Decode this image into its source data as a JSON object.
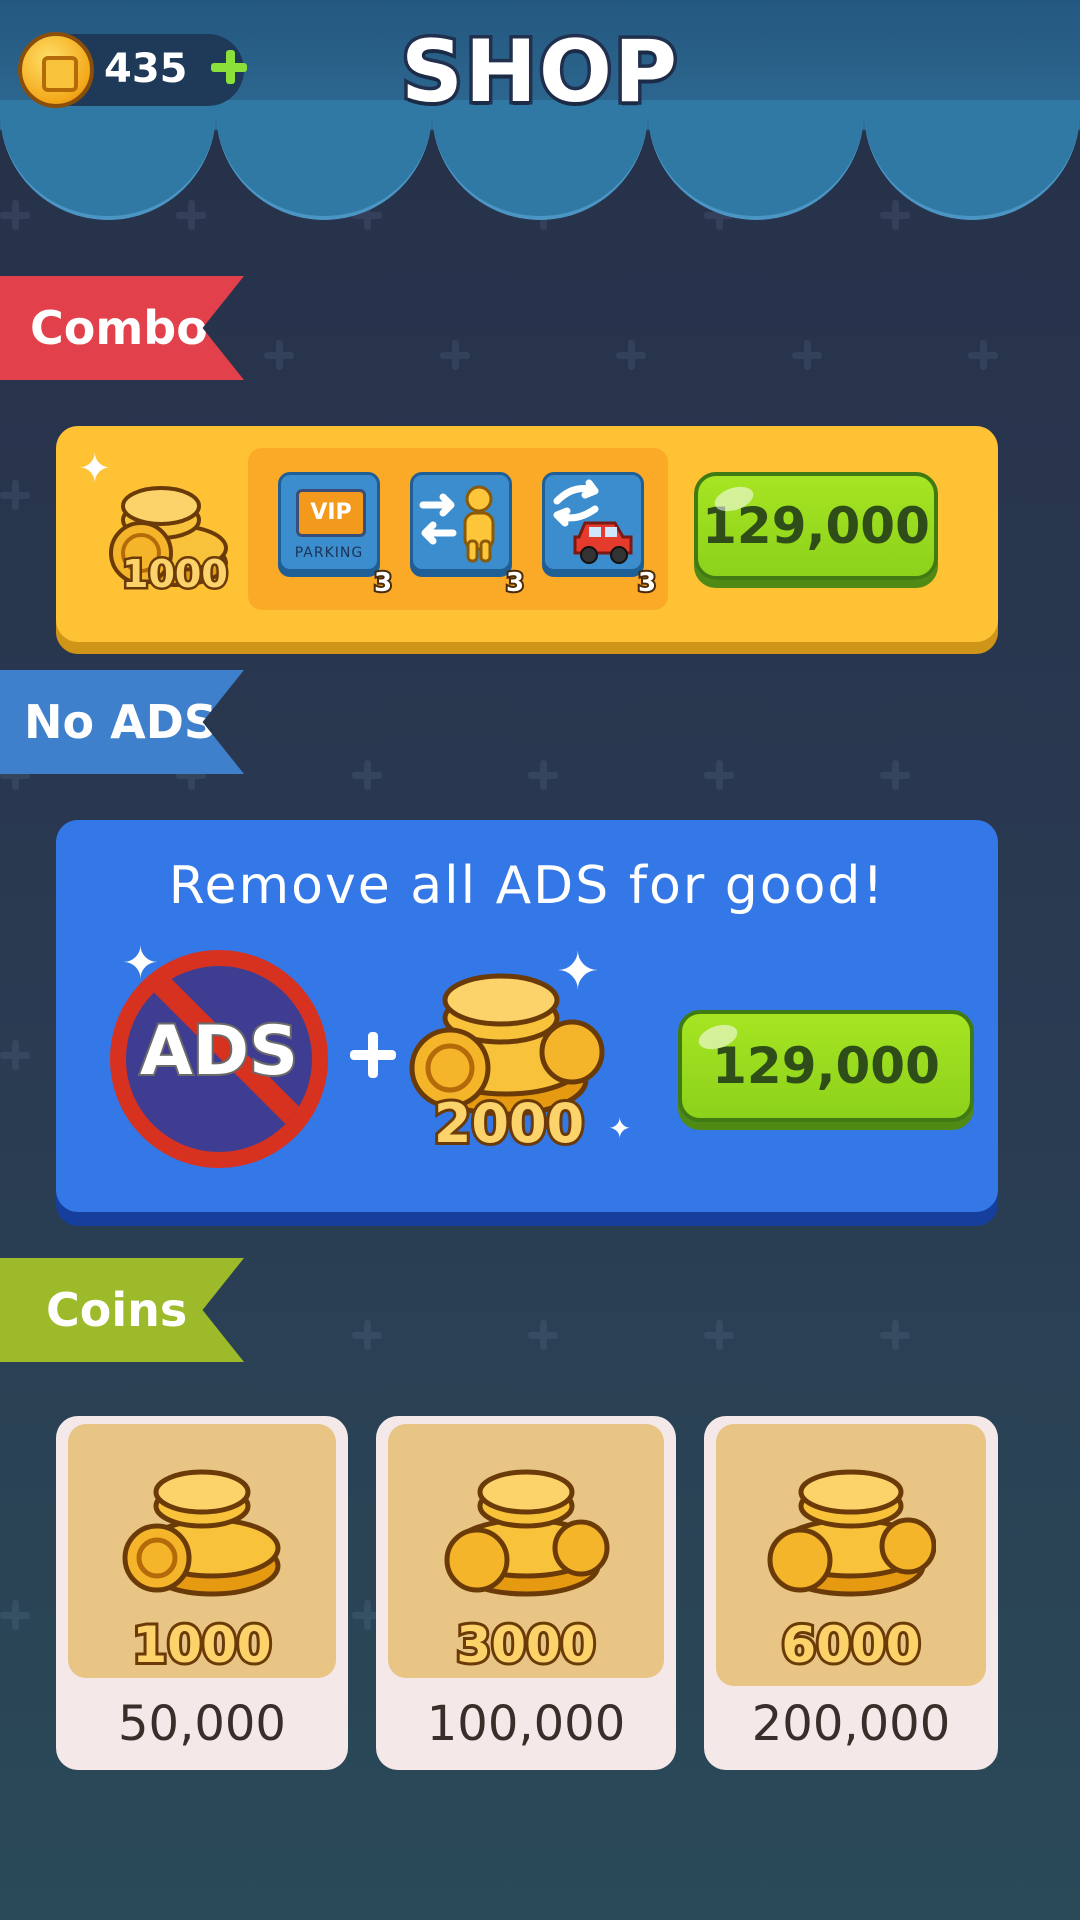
{
  "header": {
    "title": "SHOP",
    "coin_balance": "435"
  },
  "sections": {
    "combo_label": "Combo",
    "noads_label": "No ADS",
    "coins_label": "Coins"
  },
  "combo": {
    "coin_amount": "1000",
    "items": [
      {
        "name": "vip-parking",
        "badge": "VIP",
        "sub": "PARKING",
        "qty": "3"
      },
      {
        "name": "swap-person",
        "qty": "3"
      },
      {
        "name": "swap-car",
        "qty": "3"
      }
    ],
    "price": "129,000"
  },
  "noads": {
    "headline": "Remove all ADS for good!",
    "ads_label": "ADS",
    "coin_amount": "2000",
    "price": "129,000"
  },
  "coin_packs": [
    {
      "amount": "1000",
      "price": "50,000"
    },
    {
      "amount": "3000",
      "price": "100,000"
    },
    {
      "amount": "6000",
      "price": "200,000"
    }
  ],
  "colors": {
    "combo_ribbon": "#e2404a",
    "noads_ribbon": "#3f80cc",
    "coins_ribbon": "#9cba2a",
    "buy_button": "#a6e522"
  }
}
